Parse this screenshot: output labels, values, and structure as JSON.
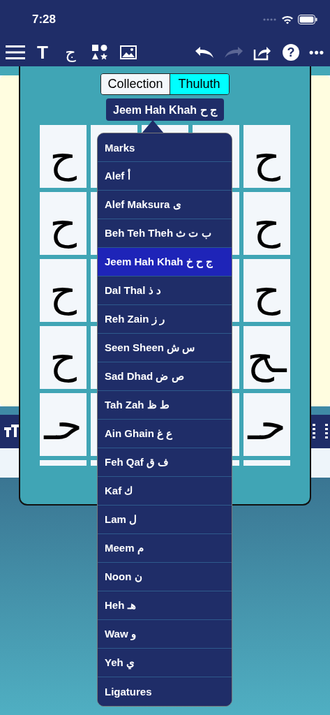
{
  "status_bar": {
    "time": "7:28"
  },
  "toolbar": {
    "text_tool": "T",
    "letter_tool": "ج",
    "help": "?",
    "more": "•••",
    "redo_disabled": true
  },
  "segmented": {
    "left": {
      "label": "Collection",
      "selected": false
    },
    "right": {
      "label": "Thuluth",
      "selected": true
    }
  },
  "group_button": {
    "label": "Jeem Hah Khah ج ح"
  },
  "grid": {
    "rows": [
      {
        "left": "ح",
        "right": "ح"
      },
      {
        "left": "ح",
        "right": "ح"
      },
      {
        "left": "ح",
        "right": "ح"
      },
      {
        "left": "ح",
        "right": "ـح"
      },
      {
        "left": "حـ",
        "right": "حـ"
      }
    ]
  },
  "menu": {
    "items": [
      {
        "label": "Marks",
        "selected": false
      },
      {
        "label": "Alef أ",
        "selected": false
      },
      {
        "label": "Alef Maksura ى",
        "selected": false
      },
      {
        "label": "Beh Teh Theh ب ت ث",
        "selected": false
      },
      {
        "label": "Jeem Hah Khah ج ح خ",
        "selected": true
      },
      {
        "label": "Dal Thal د ذ",
        "selected": false
      },
      {
        "label": "Reh Zain ر ز",
        "selected": false
      },
      {
        "label": "Seen Sheen س ش",
        "selected": false
      },
      {
        "label": "Sad Dhad ص ض",
        "selected": false
      },
      {
        "label": "Tah Zah ط ظ",
        "selected": false
      },
      {
        "label": "Ain Ghain ع غ",
        "selected": false
      },
      {
        "label": "Feh Qaf ف ق",
        "selected": false
      },
      {
        "label": "Kaf ك",
        "selected": false
      },
      {
        "label": "Lam ل",
        "selected": false
      },
      {
        "label": "Meem م",
        "selected": false
      },
      {
        "label": "Noon ن",
        "selected": false
      },
      {
        "label": "Heh هـ",
        "selected": false
      },
      {
        "label": "Waw و",
        "selected": false
      },
      {
        "label": "Yeh ي",
        "selected": false
      },
      {
        "label": "Ligatures",
        "selected": false
      }
    ]
  }
}
